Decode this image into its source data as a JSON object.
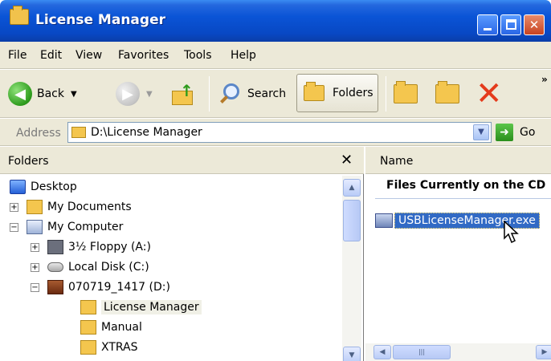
{
  "window": {
    "title": "License Manager",
    "controls": {
      "minimize": "",
      "maximize": "",
      "close": "✕"
    }
  },
  "menu": {
    "items": [
      "File",
      "Edit",
      "View",
      "Favorites",
      "Tools",
      "Help"
    ]
  },
  "toolbar": {
    "back_label": "Back",
    "search_label": "Search",
    "folders_label": "Folders",
    "more_chevron": "»"
  },
  "address": {
    "label": "Address",
    "value": "D:\\License Manager",
    "go_label": "Go"
  },
  "folders_pane": {
    "title": "Folders",
    "close_glyph": "✕",
    "tree": [
      {
        "label": "Desktop",
        "icon": "desktop-icon",
        "indent": 0,
        "expander": ""
      },
      {
        "label": "My Documents",
        "icon": "my-documents-icon",
        "indent": 1,
        "expander": "+"
      },
      {
        "label": "My Computer",
        "icon": "my-computer-icon",
        "indent": 1,
        "expander": "−"
      },
      {
        "label": "3½ Floppy (A:)",
        "icon": "floppy-drive-icon",
        "indent": 2,
        "expander": "+"
      },
      {
        "label": "Local Disk (C:)",
        "icon": "hard-disk-icon",
        "indent": 2,
        "expander": "+"
      },
      {
        "label": "070719_1417 (D:)",
        "icon": "cd-drive-icon",
        "indent": 2,
        "expander": "−"
      },
      {
        "label": "License Manager",
        "icon": "folder-open-icon",
        "indent": 3,
        "expander": "",
        "selected": true
      },
      {
        "label": "Manual",
        "icon": "folder-icon",
        "indent": 3,
        "expander": ""
      },
      {
        "label": "XTRAS",
        "icon": "folder-icon",
        "indent": 3,
        "expander": ""
      }
    ]
  },
  "right_pane": {
    "column_name": "Name",
    "group_title": "Files Currently on the CD",
    "file": "USBLicenseManager.exe"
  },
  "colors": {
    "titlebar": "#0848c4",
    "selection": "#316ac5",
    "chrome": "#ece9d8"
  }
}
